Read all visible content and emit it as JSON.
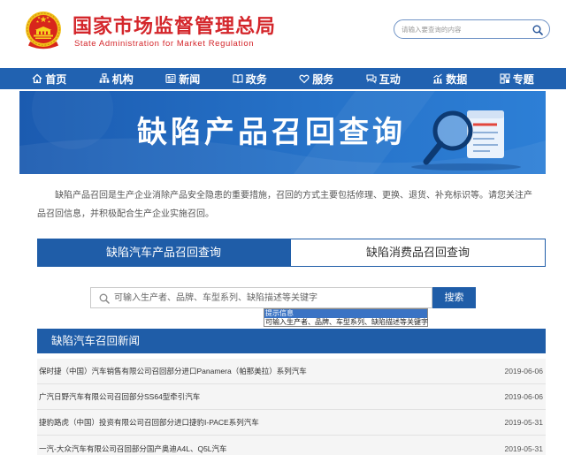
{
  "header": {
    "title_cn": "国家市场监督管理总局",
    "title_en": "State Administration for Market Regulation",
    "search_placeholder": "请输入要查询的内容",
    "logo_icon": "national-emblem",
    "search_icon": "search-icon"
  },
  "nav": {
    "items": [
      {
        "label": "首页",
        "icon": "home-icon"
      },
      {
        "label": "机构",
        "icon": "org-chart-icon"
      },
      {
        "label": "新闻",
        "icon": "newspaper-icon"
      },
      {
        "label": "政务",
        "icon": "book-icon"
      },
      {
        "label": "服务",
        "icon": "heart-icon"
      },
      {
        "label": "互动",
        "icon": "chat-icon"
      },
      {
        "label": "数据",
        "icon": "bar-chart-icon"
      },
      {
        "label": "专题",
        "icon": "grid-icon"
      }
    ]
  },
  "banner": {
    "title": "缺陷产品召回查询",
    "illustration": "magnifier-document-icon"
  },
  "intro": {
    "text": "缺陷产品召回是生产企业消除产品安全隐患的重要措施，召回的方式主要包括修理、更换、退货、补充标识等。请您关注产品召回信息，并积极配合生产企业实施召回。"
  },
  "tabs": [
    {
      "label": "缺陷汽车产品召回查询",
      "active": true
    },
    {
      "label": "缺陷消费品召回查询",
      "active": false
    }
  ],
  "search": {
    "placeholder": "可输入生产者、品牌、车型系列、缺陷描述等关键字",
    "button_label": "搜索",
    "hint_title": "提示信息",
    "hint_text": "可输入生产者、品牌、车型系列、缺陷描述等关键字"
  },
  "news": {
    "heading": "缺陷汽车召回新闻",
    "items": [
      {
        "title": "保时捷（中国）汽车销售有限公司召回部分进口Panamera（帕那美拉）系列汽车",
        "date": "2019-06-06"
      },
      {
        "title": "广汽日野汽车有限公司召回部分SS64型牵引汽车",
        "date": "2019-06-06"
      },
      {
        "title": "捷豹路虎（中国）投资有限公司召回部分进口捷豹I-PACE系列汽车",
        "date": "2019-05-31"
      },
      {
        "title": "一汽-大众汽车有限公司召回部分国产奥迪A4L、Q5L汽车",
        "date": "2019-05-31"
      }
    ]
  },
  "colors": {
    "brand_red": "#d4262b",
    "nav_blue": "#2162b1",
    "primary_blue": "#1f5da8",
    "hint_highlight": "#3a73c4",
    "row_background": "#f5f5f5"
  }
}
